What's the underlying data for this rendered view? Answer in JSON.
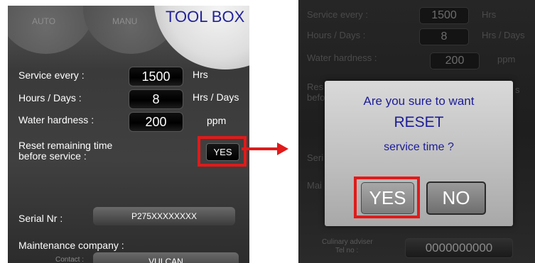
{
  "left": {
    "tabs": {
      "auto": "AUTO",
      "manu": "MANU",
      "toolbox": "TOOL BOX"
    },
    "service_every": {
      "label": "Service every :",
      "value": "1500",
      "unit": "Hrs"
    },
    "hours_days": {
      "label": "Hours / Days :",
      "value": "8",
      "unit": "Hrs / Days"
    },
    "water_hardness": {
      "label": "Water hardness :",
      "value": "200",
      "unit": "ppm"
    },
    "reset": {
      "label_line1": "Reset remaining time",
      "label_line2": "before service :",
      "button": "YES"
    },
    "serial": {
      "label": "Serial Nr :",
      "value": "P275XXXXXXXX"
    },
    "maintenance": {
      "label": "Maintenance company :",
      "contact_label": "Contact :",
      "contact_value": "VULCAN"
    }
  },
  "right": {
    "service_every": {
      "label": "Service every :",
      "value": "1500",
      "unit": "Hrs"
    },
    "hours_days": {
      "label": "Hours / Days :",
      "value": "8",
      "unit": "Hrs / Days"
    },
    "water_hardness": {
      "label": "Water hardness :",
      "value": "200",
      "unit": "ppm"
    },
    "partial_res": "Res",
    "partial_befo": "befo",
    "partial_s": "s",
    "partial_seri": "Seri",
    "partial_mai": "Mai",
    "culinary": {
      "label_line1": "Culinary adviser",
      "label_line2": "Tel no :",
      "value": "0000000000"
    },
    "dialog": {
      "line1": "Are you sure to want",
      "line2": "RESET",
      "line3": "service time ?",
      "yes": "YES",
      "no": "NO"
    }
  },
  "colors": {
    "highlight": "#e11a1a",
    "dialog_text": "#1c1c98",
    "toolbox_title": "#22229a"
  }
}
